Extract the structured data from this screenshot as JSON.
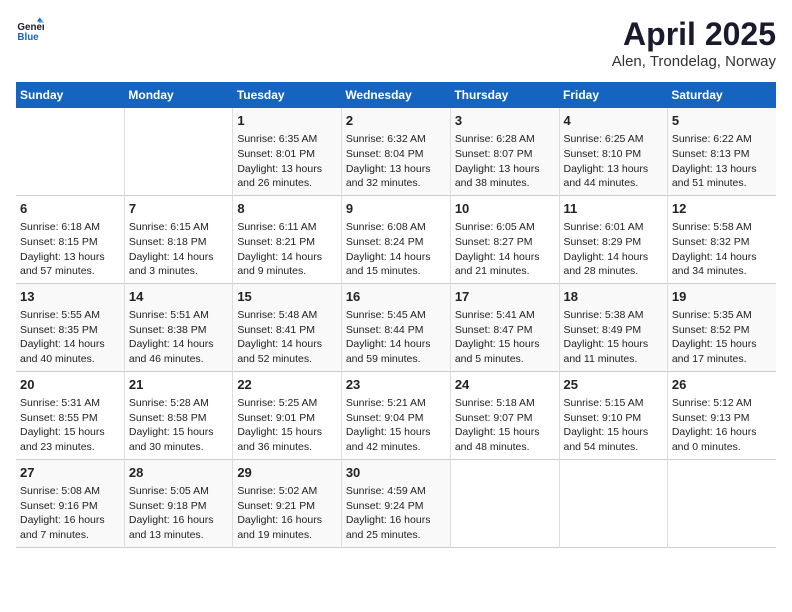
{
  "header": {
    "logo": {
      "general": "General",
      "blue": "Blue"
    },
    "title": "April 2025",
    "subtitle": "Alen, Trondelag, Norway"
  },
  "columns": [
    "Sunday",
    "Monday",
    "Tuesday",
    "Wednesday",
    "Thursday",
    "Friday",
    "Saturday"
  ],
  "weeks": [
    [
      {
        "day": "",
        "sunrise": "",
        "sunset": "",
        "daylight": ""
      },
      {
        "day": "",
        "sunrise": "",
        "sunset": "",
        "daylight": ""
      },
      {
        "day": "1",
        "sunrise": "Sunrise: 6:35 AM",
        "sunset": "Sunset: 8:01 PM",
        "daylight": "Daylight: 13 hours and 26 minutes."
      },
      {
        "day": "2",
        "sunrise": "Sunrise: 6:32 AM",
        "sunset": "Sunset: 8:04 PM",
        "daylight": "Daylight: 13 hours and 32 minutes."
      },
      {
        "day": "3",
        "sunrise": "Sunrise: 6:28 AM",
        "sunset": "Sunset: 8:07 PM",
        "daylight": "Daylight: 13 hours and 38 minutes."
      },
      {
        "day": "4",
        "sunrise": "Sunrise: 6:25 AM",
        "sunset": "Sunset: 8:10 PM",
        "daylight": "Daylight: 13 hours and 44 minutes."
      },
      {
        "day": "5",
        "sunrise": "Sunrise: 6:22 AM",
        "sunset": "Sunset: 8:13 PM",
        "daylight": "Daylight: 13 hours and 51 minutes."
      }
    ],
    [
      {
        "day": "6",
        "sunrise": "Sunrise: 6:18 AM",
        "sunset": "Sunset: 8:15 PM",
        "daylight": "Daylight: 13 hours and 57 minutes."
      },
      {
        "day": "7",
        "sunrise": "Sunrise: 6:15 AM",
        "sunset": "Sunset: 8:18 PM",
        "daylight": "Daylight: 14 hours and 3 minutes."
      },
      {
        "day": "8",
        "sunrise": "Sunrise: 6:11 AM",
        "sunset": "Sunset: 8:21 PM",
        "daylight": "Daylight: 14 hours and 9 minutes."
      },
      {
        "day": "9",
        "sunrise": "Sunrise: 6:08 AM",
        "sunset": "Sunset: 8:24 PM",
        "daylight": "Daylight: 14 hours and 15 minutes."
      },
      {
        "day": "10",
        "sunrise": "Sunrise: 6:05 AM",
        "sunset": "Sunset: 8:27 PM",
        "daylight": "Daylight: 14 hours and 21 minutes."
      },
      {
        "day": "11",
        "sunrise": "Sunrise: 6:01 AM",
        "sunset": "Sunset: 8:29 PM",
        "daylight": "Daylight: 14 hours and 28 minutes."
      },
      {
        "day": "12",
        "sunrise": "Sunrise: 5:58 AM",
        "sunset": "Sunset: 8:32 PM",
        "daylight": "Daylight: 14 hours and 34 minutes."
      }
    ],
    [
      {
        "day": "13",
        "sunrise": "Sunrise: 5:55 AM",
        "sunset": "Sunset: 8:35 PM",
        "daylight": "Daylight: 14 hours and 40 minutes."
      },
      {
        "day": "14",
        "sunrise": "Sunrise: 5:51 AM",
        "sunset": "Sunset: 8:38 PM",
        "daylight": "Daylight: 14 hours and 46 minutes."
      },
      {
        "day": "15",
        "sunrise": "Sunrise: 5:48 AM",
        "sunset": "Sunset: 8:41 PM",
        "daylight": "Daylight: 14 hours and 52 minutes."
      },
      {
        "day": "16",
        "sunrise": "Sunrise: 5:45 AM",
        "sunset": "Sunset: 8:44 PM",
        "daylight": "Daylight: 14 hours and 59 minutes."
      },
      {
        "day": "17",
        "sunrise": "Sunrise: 5:41 AM",
        "sunset": "Sunset: 8:47 PM",
        "daylight": "Daylight: 15 hours and 5 minutes."
      },
      {
        "day": "18",
        "sunrise": "Sunrise: 5:38 AM",
        "sunset": "Sunset: 8:49 PM",
        "daylight": "Daylight: 15 hours and 11 minutes."
      },
      {
        "day": "19",
        "sunrise": "Sunrise: 5:35 AM",
        "sunset": "Sunset: 8:52 PM",
        "daylight": "Daylight: 15 hours and 17 minutes."
      }
    ],
    [
      {
        "day": "20",
        "sunrise": "Sunrise: 5:31 AM",
        "sunset": "Sunset: 8:55 PM",
        "daylight": "Daylight: 15 hours and 23 minutes."
      },
      {
        "day": "21",
        "sunrise": "Sunrise: 5:28 AM",
        "sunset": "Sunset: 8:58 PM",
        "daylight": "Daylight: 15 hours and 30 minutes."
      },
      {
        "day": "22",
        "sunrise": "Sunrise: 5:25 AM",
        "sunset": "Sunset: 9:01 PM",
        "daylight": "Daylight: 15 hours and 36 minutes."
      },
      {
        "day": "23",
        "sunrise": "Sunrise: 5:21 AM",
        "sunset": "Sunset: 9:04 PM",
        "daylight": "Daylight: 15 hours and 42 minutes."
      },
      {
        "day": "24",
        "sunrise": "Sunrise: 5:18 AM",
        "sunset": "Sunset: 9:07 PM",
        "daylight": "Daylight: 15 hours and 48 minutes."
      },
      {
        "day": "25",
        "sunrise": "Sunrise: 5:15 AM",
        "sunset": "Sunset: 9:10 PM",
        "daylight": "Daylight: 15 hours and 54 minutes."
      },
      {
        "day": "26",
        "sunrise": "Sunrise: 5:12 AM",
        "sunset": "Sunset: 9:13 PM",
        "daylight": "Daylight: 16 hours and 0 minutes."
      }
    ],
    [
      {
        "day": "27",
        "sunrise": "Sunrise: 5:08 AM",
        "sunset": "Sunset: 9:16 PM",
        "daylight": "Daylight: 16 hours and 7 minutes."
      },
      {
        "day": "28",
        "sunrise": "Sunrise: 5:05 AM",
        "sunset": "Sunset: 9:18 PM",
        "daylight": "Daylight: 16 hours and 13 minutes."
      },
      {
        "day": "29",
        "sunrise": "Sunrise: 5:02 AM",
        "sunset": "Sunset: 9:21 PM",
        "daylight": "Daylight: 16 hours and 19 minutes."
      },
      {
        "day": "30",
        "sunrise": "Sunrise: 4:59 AM",
        "sunset": "Sunset: 9:24 PM",
        "daylight": "Daylight: 16 hours and 25 minutes."
      },
      {
        "day": "",
        "sunrise": "",
        "sunset": "",
        "daylight": ""
      },
      {
        "day": "",
        "sunrise": "",
        "sunset": "",
        "daylight": ""
      },
      {
        "day": "",
        "sunrise": "",
        "sunset": "",
        "daylight": ""
      }
    ]
  ]
}
